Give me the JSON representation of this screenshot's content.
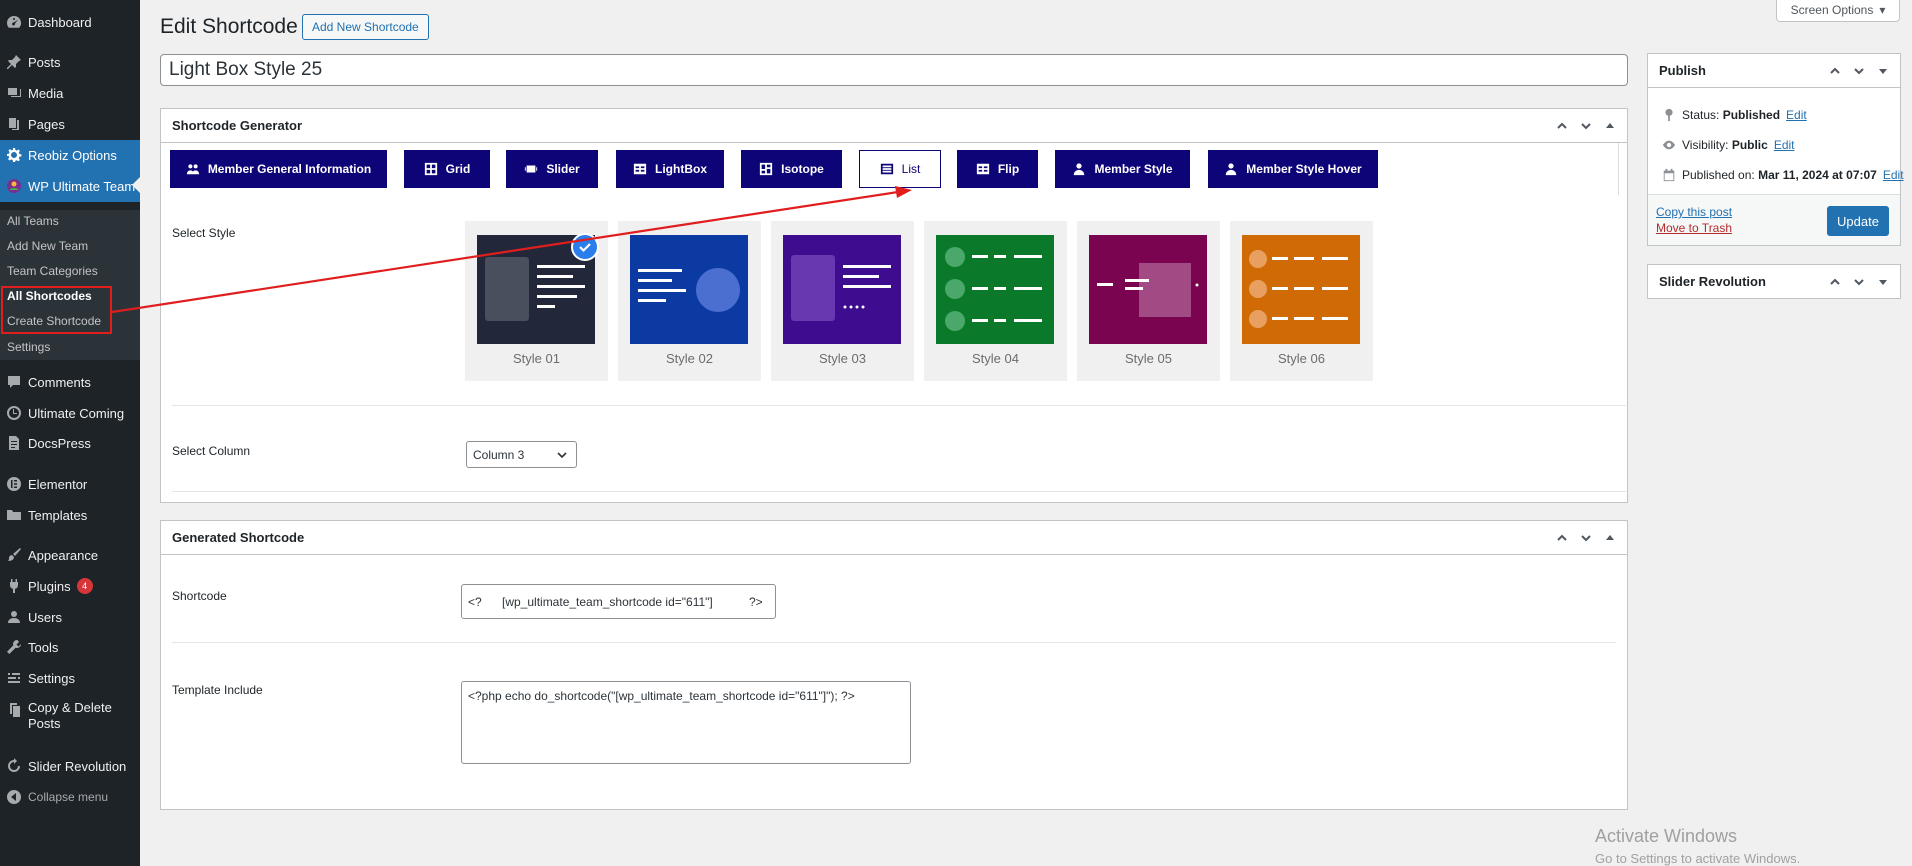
{
  "sidebar": {
    "items": [
      {
        "label": "Dashboard",
        "icon": "dashboard-icon"
      },
      {
        "label": "Posts",
        "icon": "pin-icon"
      },
      {
        "label": "Media",
        "icon": "media-icon"
      },
      {
        "label": "Pages",
        "icon": "pages-icon"
      },
      {
        "label": "Reobiz Options",
        "icon": "gear-icon"
      },
      {
        "label": "WP Ultimate Team",
        "icon": "team-logo-icon"
      },
      {
        "label": "Comments",
        "icon": "comment-icon"
      },
      {
        "label": "Ultimate Coming",
        "icon": "clock-icon"
      },
      {
        "label": "DocsPress",
        "icon": "docs-icon"
      },
      {
        "label": "Elementor",
        "icon": "elementor-icon"
      },
      {
        "label": "Templates",
        "icon": "folder-icon"
      },
      {
        "label": "Appearance",
        "icon": "brush-icon"
      },
      {
        "label": "Plugins",
        "icon": "plug-icon",
        "badge": "4"
      },
      {
        "label": "Users",
        "icon": "user-icon"
      },
      {
        "label": "Tools",
        "icon": "wrench-icon"
      },
      {
        "label": "Settings",
        "icon": "settings-icon"
      },
      {
        "label": "Copy & Delete Posts",
        "icon": "copy-icon"
      },
      {
        "label": "Slider Revolution",
        "icon": "refresh-icon"
      }
    ],
    "submenu": [
      "All Teams",
      "Add New Team",
      "Team Categories",
      "All Shortcodes",
      "Create Shortcode",
      "Settings"
    ],
    "collapse_label": "Collapse menu"
  },
  "header": {
    "title": "Edit Shortcode",
    "add_new_label": "Add New Shortcode",
    "screen_options": "Screen Options"
  },
  "title_value": "Light Box Style 25",
  "generator": {
    "title": "Shortcode Generator",
    "tabs": [
      {
        "label": "Member General Information",
        "icon": "users-icon"
      },
      {
        "label": "Grid",
        "icon": "grid-icon"
      },
      {
        "label": "Slider",
        "icon": "slider-icon"
      },
      {
        "label": "LightBox",
        "icon": "table-icon"
      },
      {
        "label": "Isotope",
        "icon": "isotope-icon"
      },
      {
        "label": "List",
        "icon": "list-icon"
      },
      {
        "label": "Flip",
        "icon": "table-icon"
      },
      {
        "label": "Member Style",
        "icon": "member-icon"
      },
      {
        "label": "Member Style Hover",
        "icon": "member-icon"
      }
    ],
    "selected_tab": "List",
    "select_style_label": "Select Style",
    "styles": [
      {
        "label": "Style 01",
        "color": "#22273a"
      },
      {
        "label": "Style 02",
        "color": "#0c3aa3"
      },
      {
        "label": "Style 03",
        "color": "#3d0c8f"
      },
      {
        "label": "Style 04",
        "color": "#0a7a2a"
      },
      {
        "label": "Style 05",
        "color": "#7b0450"
      },
      {
        "label": "Style 06",
        "color": "#cf6a05"
      }
    ],
    "selected_style": "Style 01",
    "select_column_label": "Select Column",
    "column_value": "Column 3"
  },
  "generated": {
    "title": "Generated Shortcode",
    "shortcode_label": "Shortcode",
    "shortcode_open": "<?",
    "shortcode_value": "[wp_ultimate_team_shortcode id=\"611\"]",
    "shortcode_close": "?>",
    "template_label": "Template Include",
    "template_value": "<?php echo do_shortcode(\"[wp_ultimate_team_shortcode id=\"611\"]\"); ?>"
  },
  "publish": {
    "title": "Publish",
    "status_label": "Status:",
    "status_value": "Published",
    "visibility_label": "Visibility:",
    "visibility_value": "Public",
    "published_on_label": "Published on:",
    "published_on_value": "Mar 11, 2024 at 07:07",
    "edit_label": "Edit",
    "copy_label": "Copy this post",
    "trash_label": "Move to Trash",
    "update_label": "Update"
  },
  "slider_rev": {
    "title": "Slider Revolution"
  },
  "watermark": {
    "line1": "Activate Windows",
    "line2": "Go to Settings to activate Windows."
  },
  "colors": {
    "accent": "#2271b1",
    "tab_bg": "#0d0477",
    "highlight": "#e01e1e"
  }
}
